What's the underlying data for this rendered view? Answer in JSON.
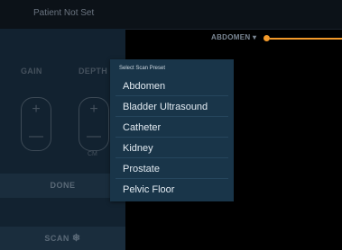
{
  "topbar": {
    "patient": "Patient Not Set"
  },
  "controls": {
    "gain_label": "GAIN",
    "depth_label": "DEPTH",
    "depth_unit": "CM",
    "plus": "+",
    "minus": "—"
  },
  "buttons": {
    "done": "DONE",
    "scan": "SCAN",
    "scan_icon": "❄"
  },
  "preset": {
    "current": "ABDOMEN ▾"
  },
  "menu": {
    "title": "Select Scan Preset",
    "items": [
      {
        "label": "Abdomen"
      },
      {
        "label": "Bladder Ultrasound"
      },
      {
        "label": "Catheter"
      },
      {
        "label": "Kidney"
      },
      {
        "label": "Prostate"
      },
      {
        "label": "Pelvic Floor"
      }
    ]
  },
  "colors": {
    "accent": "#f39a2b",
    "menu_bg": "#193549",
    "panel_bg": "#122230"
  }
}
